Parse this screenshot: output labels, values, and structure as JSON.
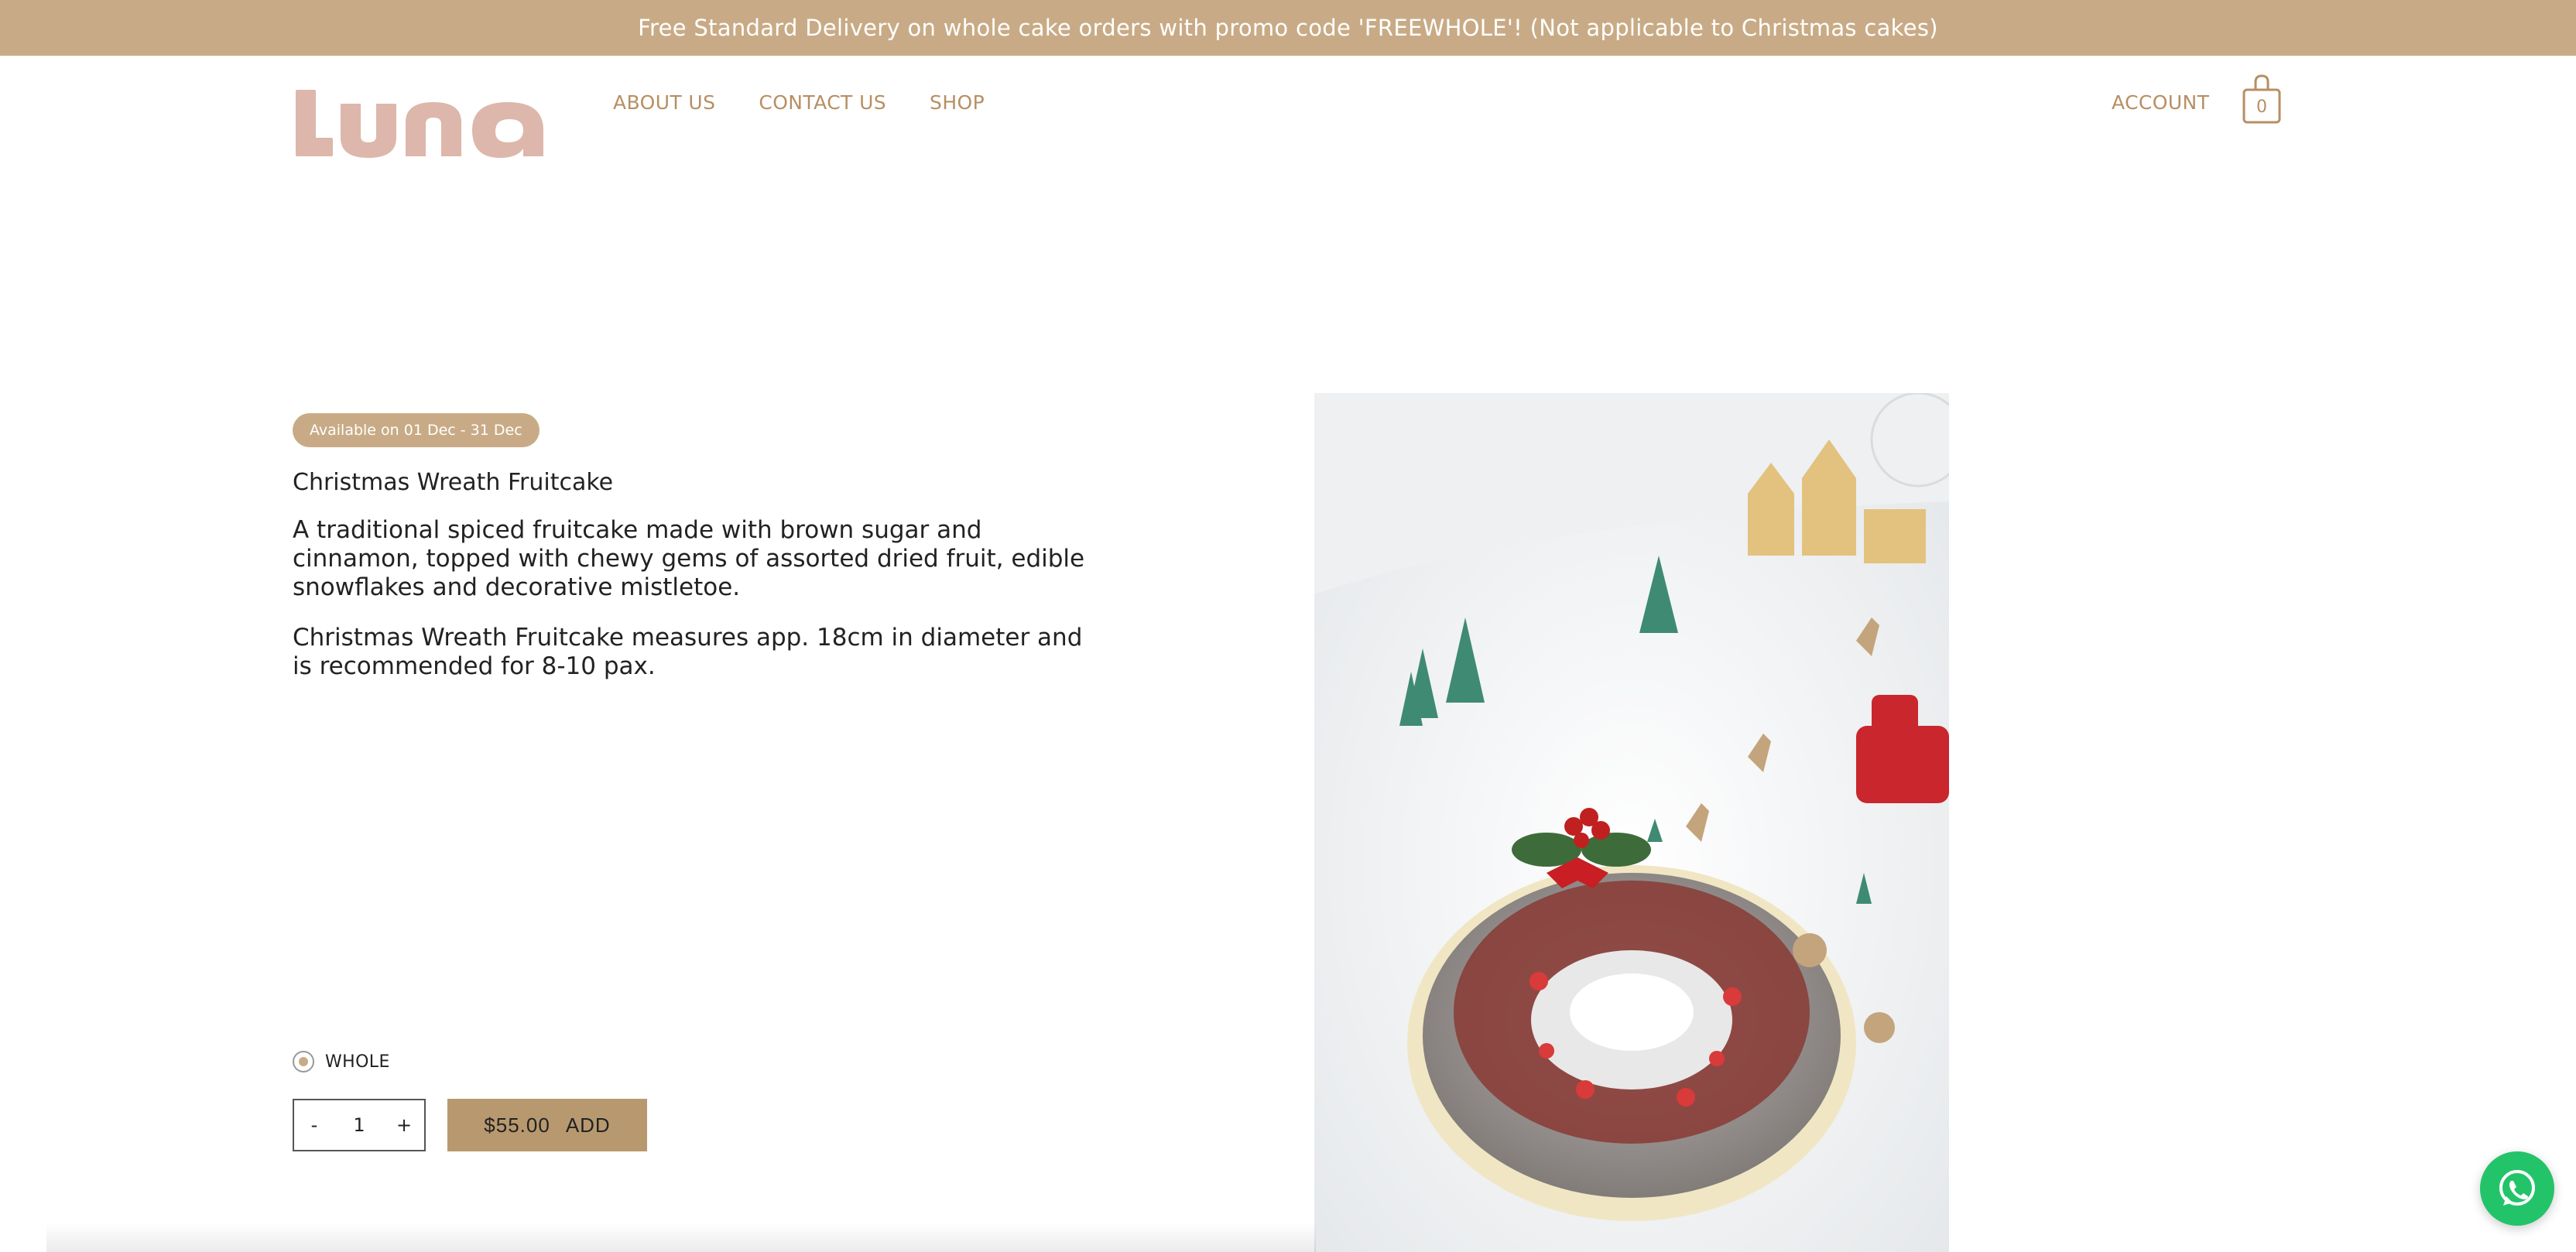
{
  "promo": {
    "text": "Free Standard Delivery on whole cake orders with promo code 'FREEWHOLE'! (Not applicable to Christmas cakes)"
  },
  "header": {
    "logo_text": "Luna",
    "nav": [
      {
        "label": "ABOUT US"
      },
      {
        "label": "CONTACT US"
      },
      {
        "label": "SHOP"
      }
    ],
    "account_label": "ACCOUNT",
    "cart_count": "0"
  },
  "product": {
    "availability_badge": "Available on 01 Dec - 31 Dec",
    "title": "Christmas Wreath Fruitcake",
    "description": "A traditional spiced fruitcake made with brown sugar and cinnamon, topped with chewy gems of assorted dried fruit, edible snowflakes and decorative mistletoe.",
    "size_note": "Christmas Wreath Fruitcake measures app. 18cm in diameter and is recommended for 8-10 pax.",
    "variant_label": "WHOLE",
    "quantity": "1",
    "decrement_label": "-",
    "increment_label": "+",
    "price": "$55.00",
    "add_label": "ADD"
  },
  "colors": {
    "accent": "#c8ab86",
    "nav_text": "#b78f63",
    "button": "#b8996f",
    "logo": "#ddb7ab",
    "whatsapp": "#23c36a"
  },
  "icons": [
    "cart-icon",
    "whatsapp-icon",
    "radio-icon"
  ]
}
